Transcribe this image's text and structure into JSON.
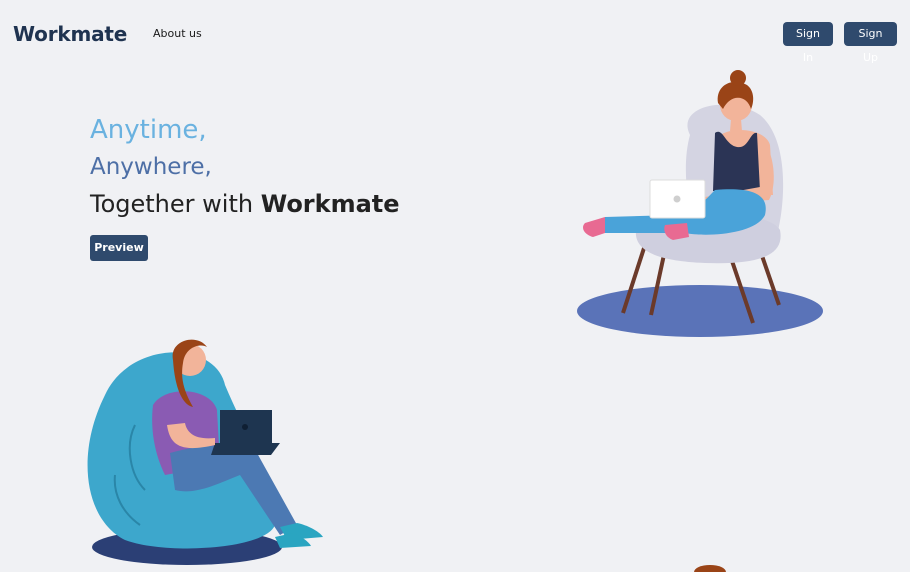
{
  "navbar": {
    "brand": "Workmate",
    "about_label": "About us",
    "signin_label": "Sign In",
    "signup_label": "Sign Up"
  },
  "hero": {
    "line1": "Anytime,",
    "line2": "Anywhere,",
    "line3_prefix": "Together with ",
    "line3_strong": "Workmate",
    "preview_label": "Preview"
  },
  "colors": {
    "navy": "#2f4a6d",
    "light_blue": "#6ab2e0",
    "mid_blue": "#4d6fa6",
    "background": "#f0f1f4"
  },
  "illustrations": {
    "top_right": "woman-with-laptop-on-chair-illustration",
    "bottom_left": "woman-with-laptop-on-beanbag-illustration"
  }
}
